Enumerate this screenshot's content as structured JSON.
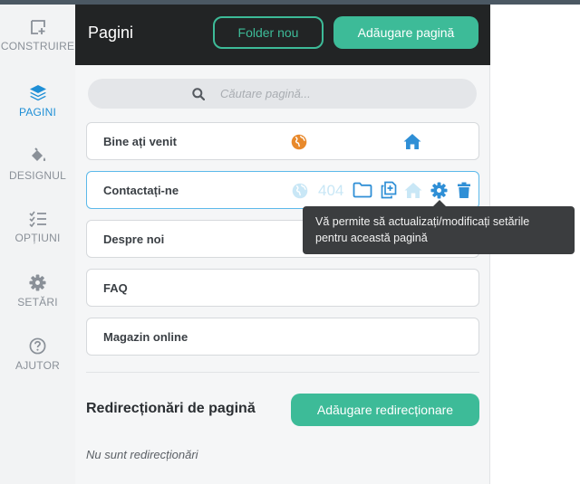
{
  "sidebar": {
    "items": [
      {
        "label": "CONSTRUIRE",
        "icon": "build-add-icon",
        "active": false
      },
      {
        "label": "PAGINI",
        "icon": "layers-icon",
        "active": true
      },
      {
        "label": "DESIGNUL",
        "icon": "paint-bucket-icon",
        "active": false
      },
      {
        "label": "OPȚIUNI",
        "icon": "checklist-icon",
        "active": false
      },
      {
        "label": "SETĂRI",
        "icon": "gear-icon",
        "active": false
      },
      {
        "label": "AJUTOR",
        "icon": "help-icon",
        "active": false
      }
    ]
  },
  "panel": {
    "title": "Pagini",
    "new_folder_label": "Folder nou",
    "add_page_label": "Adăugare pagină",
    "search": {
      "placeholder": "Căutare pagină..."
    },
    "pages": [
      {
        "name": "Bine ați venit",
        "icons": [
          "globe-icon",
          "home-icon"
        ]
      },
      {
        "name": "Contactați-ne",
        "selected": true,
        "badge_404": "404",
        "icons": [
          "globe-icon",
          "folder-icon",
          "duplicate-icon",
          "home-icon",
          "gear-icon",
          "trash-icon"
        ]
      },
      {
        "name": "Despre noi"
      },
      {
        "name": "FAQ"
      },
      {
        "name": "Magazin online"
      }
    ],
    "redirects": {
      "title": "Redirecționări de pagină",
      "add_label": "Adăugare redirecționare",
      "empty_text": "Nu sunt redirecționări"
    }
  },
  "tooltip": {
    "text": "Vă permite să actualizați/modificați setările pentru această pagină"
  },
  "colors": {
    "accent_green": "#3dbb98",
    "active_blue": "#1f8fd6",
    "globe_orange": "#e8892b",
    "header_dark": "#222425"
  }
}
